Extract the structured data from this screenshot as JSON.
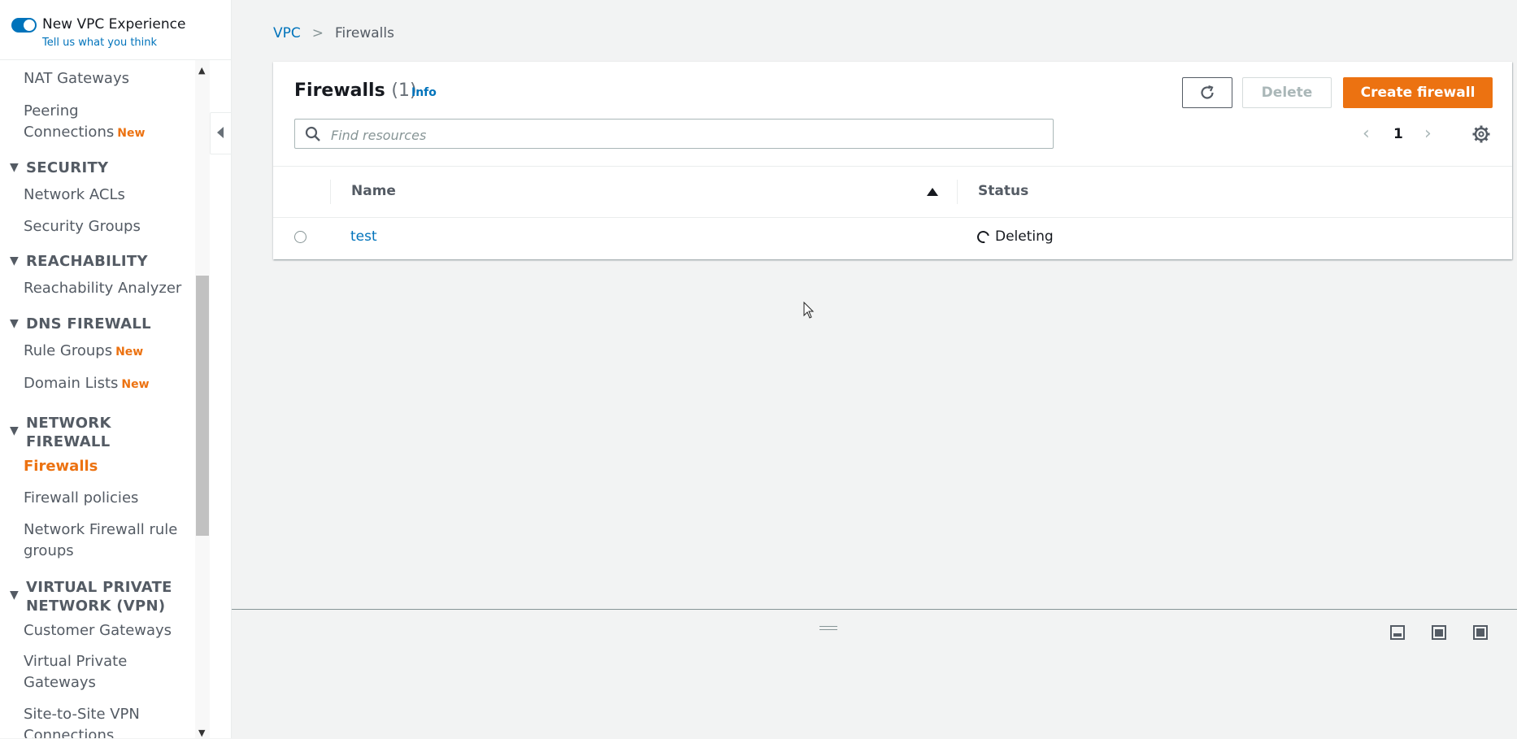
{
  "sidebar": {
    "experience_toggle_label": "New VPC Experience",
    "feedback_link": "Tell us what you think",
    "new_badge": "New",
    "items": [
      {
        "label": "NAT Gateways"
      },
      {
        "label_line1": "Peering",
        "label_line2": "Connections",
        "badge": "New"
      },
      {
        "section": "SECURITY"
      },
      {
        "label": "Network ACLs"
      },
      {
        "label": "Security Groups"
      },
      {
        "section": "REACHABILITY"
      },
      {
        "label": "Reachability Analyzer"
      },
      {
        "section": "DNS FIREWALL"
      },
      {
        "label": "Rule Groups",
        "badge": "New"
      },
      {
        "label": "Domain Lists",
        "badge": "New"
      },
      {
        "section_line1": "NETWORK",
        "section_line2": "FIREWALL"
      },
      {
        "label": "Firewalls",
        "active": true
      },
      {
        "label": "Firewall policies"
      },
      {
        "label_line1": "Network Firewall rule",
        "label_line2": "groups"
      },
      {
        "section_line1": "VIRTUAL PRIVATE",
        "section_line2": "NETWORK (VPN)"
      },
      {
        "label": "Customer Gateways"
      },
      {
        "label_line1": "Virtual Private",
        "label_line2": "Gateways"
      },
      {
        "label_line1": "Site-to-Site VPN",
        "label_line2": "Connections"
      }
    ]
  },
  "breadcrumb": {
    "parent": "VPC",
    "current": "Firewalls"
  },
  "panel": {
    "title": "Firewalls",
    "count": "(1)",
    "info": "Info",
    "delete_label": "Delete",
    "create_label": "Create firewall",
    "search_placeholder": "Find resources",
    "page": "1"
  },
  "table": {
    "columns": [
      "Name",
      "Status"
    ],
    "sort_column": "Name",
    "sort_direction": "ascending",
    "rows": [
      {
        "name": "test",
        "status": "Deleting",
        "selected": false
      }
    ]
  },
  "colors": {
    "accent": "#ec7211",
    "link": "#0073bb",
    "background": "#f2f3f3"
  },
  "icons": [
    "search-icon",
    "refresh-icon",
    "settings-icon",
    "sort-asc-icon",
    "spinner-icon",
    "chevron-left-icon",
    "chevron-right-icon",
    "collapse-sidebar-icon",
    "layout-bottom-icon",
    "layout-side-icon",
    "layout-full-icon",
    "cursor-icon"
  ]
}
